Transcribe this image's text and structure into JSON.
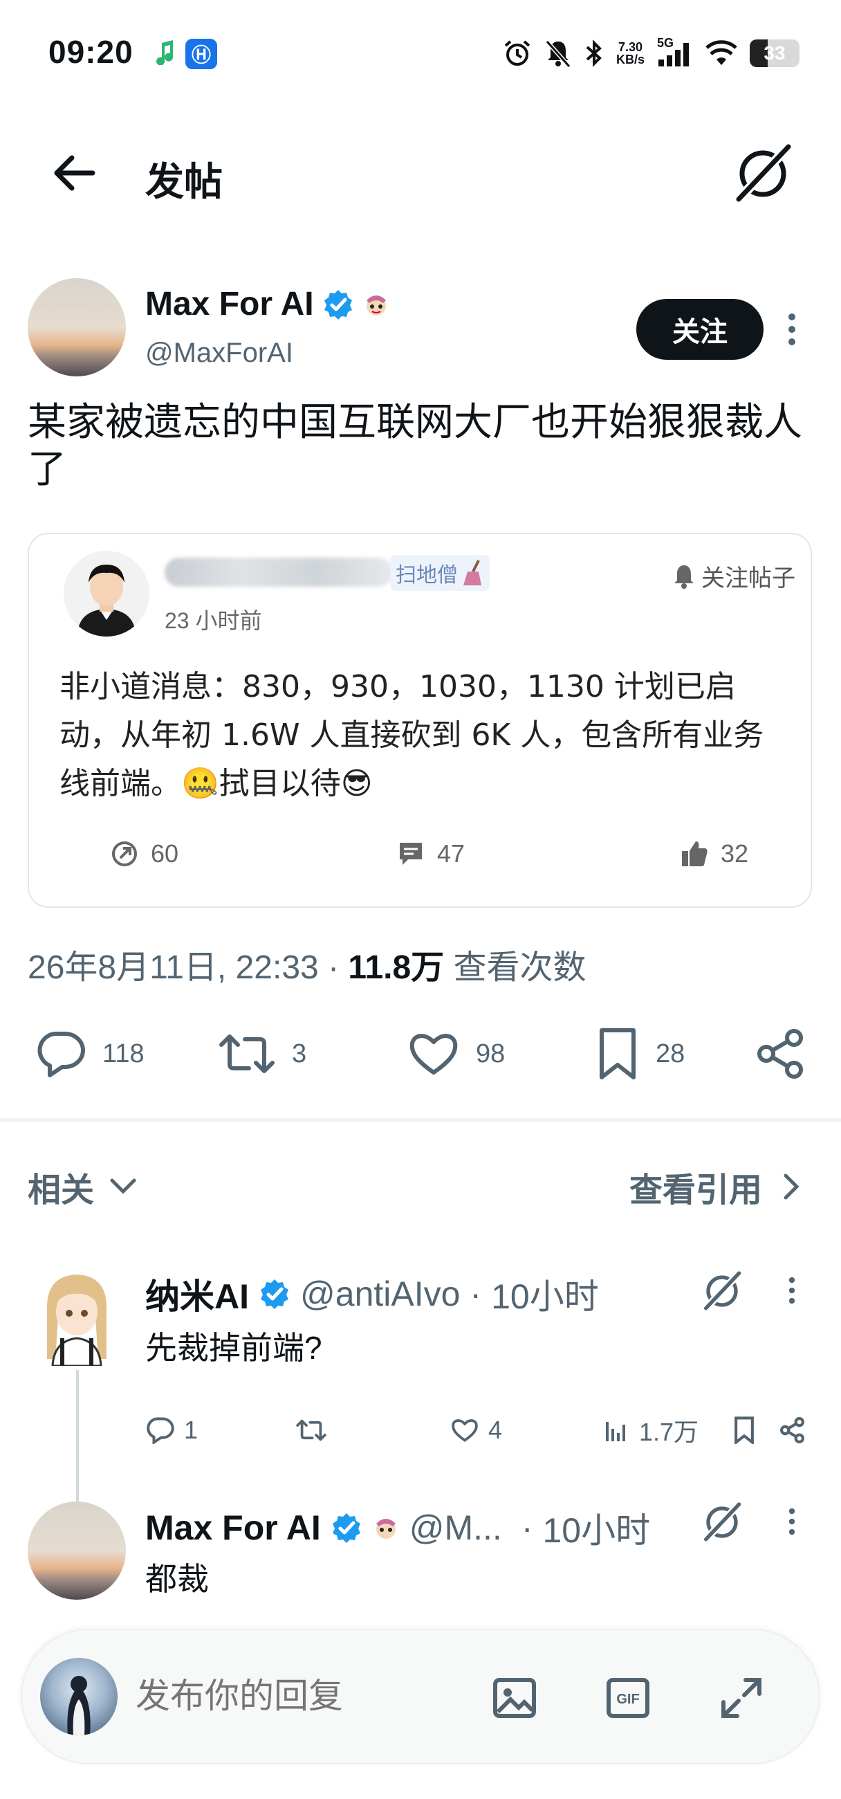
{
  "status_bar": {
    "time": "09:20",
    "net_speed_value": "7.30",
    "net_speed_unit": "KB/s",
    "network": "5G",
    "battery": "33",
    "battery_level": 0.33
  },
  "header": {
    "title": "发帖"
  },
  "post": {
    "author_name": "Max For AI",
    "author_handle": "@MaxForAI",
    "follow_label": "关注",
    "text": "某家被遗忘的中国互联网大厂也开始狠狠裁人了",
    "quote": {
      "badge": "扫地僧",
      "time": "23 小时前",
      "follow_label": "关注帖子",
      "text": "非小道消息：830，930，1030，1130 计划已启动，从年初 1.6W 人直接砍到 6K 人，包含所有业务线前端。🤐拭目以待😎",
      "stats": {
        "shares": "60",
        "comments": "47",
        "likes": "32"
      }
    },
    "date": "26年8月11日, 22:33",
    "separator": "·",
    "views_count": "11.8万",
    "views_label": "查看次数",
    "actions": {
      "replies": "118",
      "reposts": "3",
      "likes": "98",
      "bookmarks": "28"
    }
  },
  "related": {
    "label": "相关",
    "see_quotes": "查看引用"
  },
  "replies": [
    {
      "name": "纳米AI",
      "handle": "@antiAIvo",
      "separator": "·",
      "time": "10小时",
      "text": "先裁掉前端?",
      "stats": {
        "replies": "1",
        "reposts": "",
        "likes": "4",
        "views": "1.7万"
      }
    },
    {
      "name": "Max For AI",
      "handle": "@M...",
      "separator": "·",
      "time": "10小时",
      "text": "都裁"
    }
  ],
  "compose": {
    "placeholder": "发布你的回复"
  },
  "colors": {
    "accent": "#1d9bf0",
    "text": "#0f1419",
    "muted": "#536471"
  }
}
